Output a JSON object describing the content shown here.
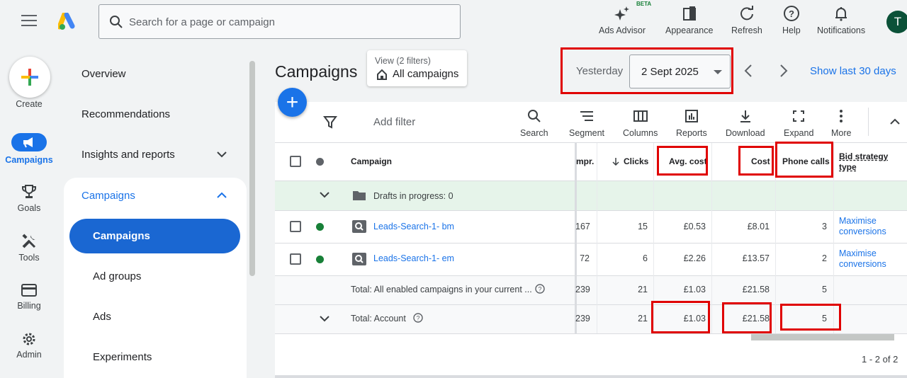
{
  "topbar": {
    "search_placeholder": "Search for a page or campaign",
    "tools": [
      {
        "label": "Ads Advisor",
        "badge": "BETA",
        "icon": "sparkle-icon"
      },
      {
        "label": "Appearance",
        "icon": "appearance-icon"
      },
      {
        "label": "Refresh",
        "icon": "refresh-icon"
      },
      {
        "label": "Help",
        "icon": "help-icon"
      },
      {
        "label": "Notifications",
        "icon": "bell-icon"
      }
    ],
    "avatar_initial": "T"
  },
  "rail": {
    "items": [
      {
        "label": "Create",
        "icon": "plus-icon"
      },
      {
        "label": "Campaigns",
        "icon": "megaphone-icon"
      },
      {
        "label": "Goals",
        "icon": "trophy-icon"
      },
      {
        "label": "Tools",
        "icon": "tools-icon"
      },
      {
        "label": "Billing",
        "icon": "card-icon"
      },
      {
        "label": "Admin",
        "icon": "gear-icon"
      }
    ]
  },
  "nav": {
    "items": [
      "Overview",
      "Recommendations",
      "Insights and reports",
      "Campaigns",
      "Campaigns",
      "Ad groups",
      "Ads",
      "Experiments"
    ]
  },
  "main": {
    "title": "Campaigns",
    "view_label": "View (2 filters)",
    "view_value": "All campaigns",
    "date_label": "Yesterday",
    "date_value": "2 Sept 2025",
    "show_last": "Show last 30 days",
    "add_filter": "Add filter",
    "toolbar": [
      "Search",
      "Segment",
      "Columns",
      "Reports",
      "Download",
      "Expand",
      "More"
    ]
  },
  "table": {
    "headers": {
      "campaign": "Campaign",
      "impr": "mpr.",
      "clicks": "Clicks",
      "avg_cost": "Avg. cost",
      "cost": "Cost",
      "phone_calls": "Phone calls",
      "bid_strategy": "Bid strategy type"
    },
    "drafts": "Drafts in progress: 0",
    "rows": [
      {
        "name": "Leads-Search-1- bm",
        "impr": "167",
        "clicks": "15",
        "avg_cost": "£0.53",
        "cost": "£8.01",
        "calls": "3",
        "bid1": "Maximise",
        "bid2": "conversions",
        "status_color": "#188038"
      },
      {
        "name": "Leads-Search-1- em",
        "impr": "72",
        "clicks": "6",
        "avg_cost": "£2.26",
        "cost": "£13.57",
        "calls": "2",
        "bid1": "Maximise",
        "bid2": "conversions",
        "status_color": "#188038"
      }
    ],
    "total_enabled": {
      "label": "Total: All enabled campaigns in your current ...",
      "impr": "239",
      "clicks": "21",
      "avg_cost": "£1.03",
      "cost": "£21.58",
      "calls": "5"
    },
    "total_account": {
      "label": "Total: Account",
      "impr": "239",
      "clicks": "21",
      "avg_cost": "£1.03",
      "cost": "£21.58",
      "calls": "5"
    },
    "pager": "1 - 2 of 2"
  },
  "colors": {
    "accent": "#1a73e8",
    "highlight": "#e00000",
    "draft_bg": "#e6f4ea"
  }
}
